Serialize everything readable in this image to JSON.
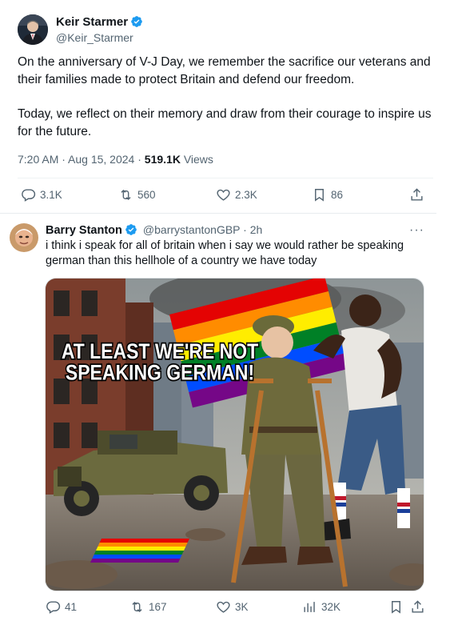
{
  "main_tweet": {
    "author_name": "Keir Starmer",
    "author_handle": "@Keir_Starmer",
    "paragraph1": "On the anniversary of V-J Day, we remember the sacrifice our veterans and their families made to protect Britain and defend our freedom.",
    "paragraph2": "Today, we reflect on their memory and draw from their courage to inspire us for the future.",
    "timestamp": "7:20 AM · Aug 15, 2024 · ",
    "views_count": "519.1K",
    "views_label": " Views",
    "actions": {
      "replies": "3.1K",
      "reposts": "560",
      "likes": "2.3K",
      "bookmarks": "86"
    }
  },
  "reply_tweet": {
    "author_name": "Barry Stanton",
    "author_handle": "@barrystantonGBP · 2h",
    "text": "i think i speak for all of britain when i say we would rather be speaking german than this hellhole of a country we have today",
    "image_caption_line1": "AT LEAST WE'RE NOT",
    "image_caption_line2": "SPEAKING GERMAN!",
    "actions": {
      "replies": "41",
      "reposts": "167",
      "likes": "3K",
      "views": "32K"
    }
  },
  "colors": {
    "verified": "#1d9bf0",
    "text": "#0f1419",
    "secondary": "#536471"
  },
  "icons": [
    "verified-badge-icon",
    "reply-icon",
    "repost-icon",
    "like-icon",
    "bookmark-icon",
    "share-icon",
    "views-icon",
    "more-icon"
  ]
}
